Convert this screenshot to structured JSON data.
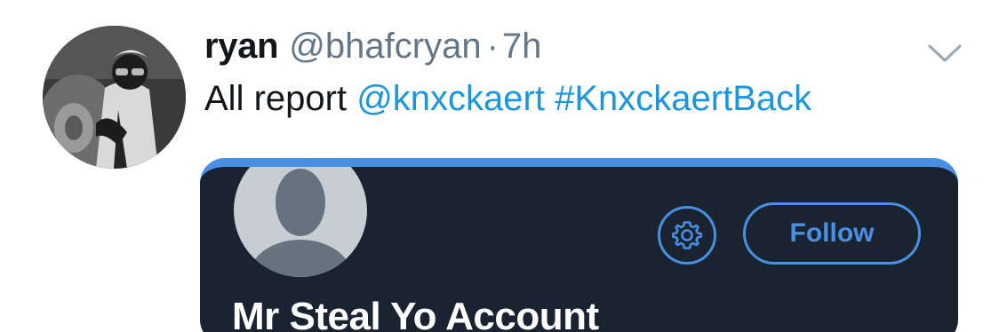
{
  "tweet": {
    "author_name": "ryan",
    "author_handle": "@bhafcryan",
    "separator": "·",
    "timestamp": "7h",
    "text_plain": "All report",
    "mention": "@knxckaert",
    "hashtag": "#KnxckaertBack",
    "menu_icon": "chevron-down-icon",
    "avatar_icon": "profile-photo"
  },
  "embedded_profile": {
    "display_name": "Mr Steal Yo Account",
    "follow_label": "Follow",
    "settings_icon": "gear-icon",
    "avatar_icon": "default-avatar-icon"
  },
  "colors": {
    "link": "#1b95e0",
    "embed_background": "#1a2430",
    "accent": "#4a90e2",
    "text_primary": "#14171a",
    "text_secondary": "#657786"
  }
}
